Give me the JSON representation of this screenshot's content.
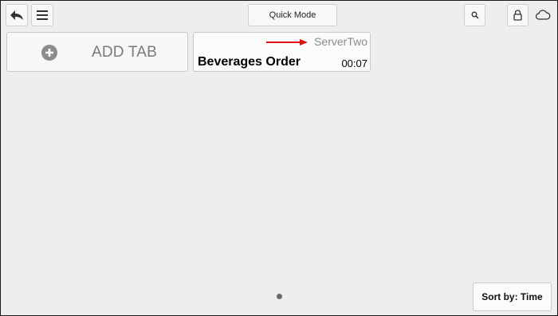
{
  "toolbar": {
    "back_icon": "back-arrow-icon",
    "menu_icon": "hamburger-menu-icon",
    "quick_mode_label": "Quick Mode",
    "search_icon": "search-icon",
    "lock_icon": "lock-icon",
    "cloud_icon": "cloud-icon"
  },
  "tabs": {
    "add_tab": {
      "icon": "plus-circle-icon",
      "label": "ADD TAB"
    },
    "items": [
      {
        "server": "ServerTwo",
        "title": "Beverages Order",
        "time": "00:07"
      }
    ]
  },
  "annotation": {
    "arrow_color": "#e01010"
  },
  "footer": {
    "sort_label": "Sort by: Time"
  }
}
